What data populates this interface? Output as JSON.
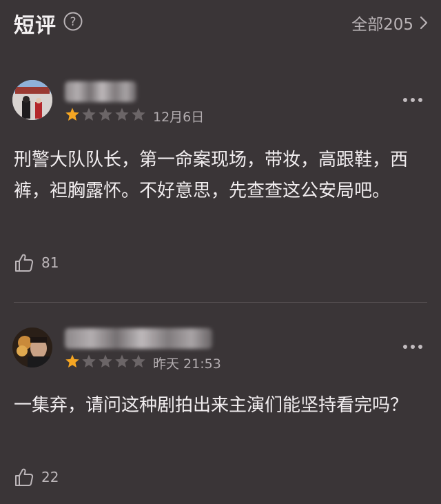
{
  "header": {
    "title": "短评",
    "all_label": "全部205"
  },
  "comments": [
    {
      "rating": 1,
      "date": "12月6日",
      "text": "刑警大队队长，第一命案现场，带妆，高跟鞋，西裤，袒胸露怀。不好意思，先查查这公安局吧。",
      "likes": "81"
    },
    {
      "rating": 1,
      "date": "昨天 21:53",
      "text": "一集弃，请问这种剧拍出来主演们能坚持看完吗？",
      "likes": "22"
    }
  ],
  "colors": {
    "background": "#3a3537",
    "star_active": "#f5a623",
    "star_inactive": "#6b6567"
  }
}
